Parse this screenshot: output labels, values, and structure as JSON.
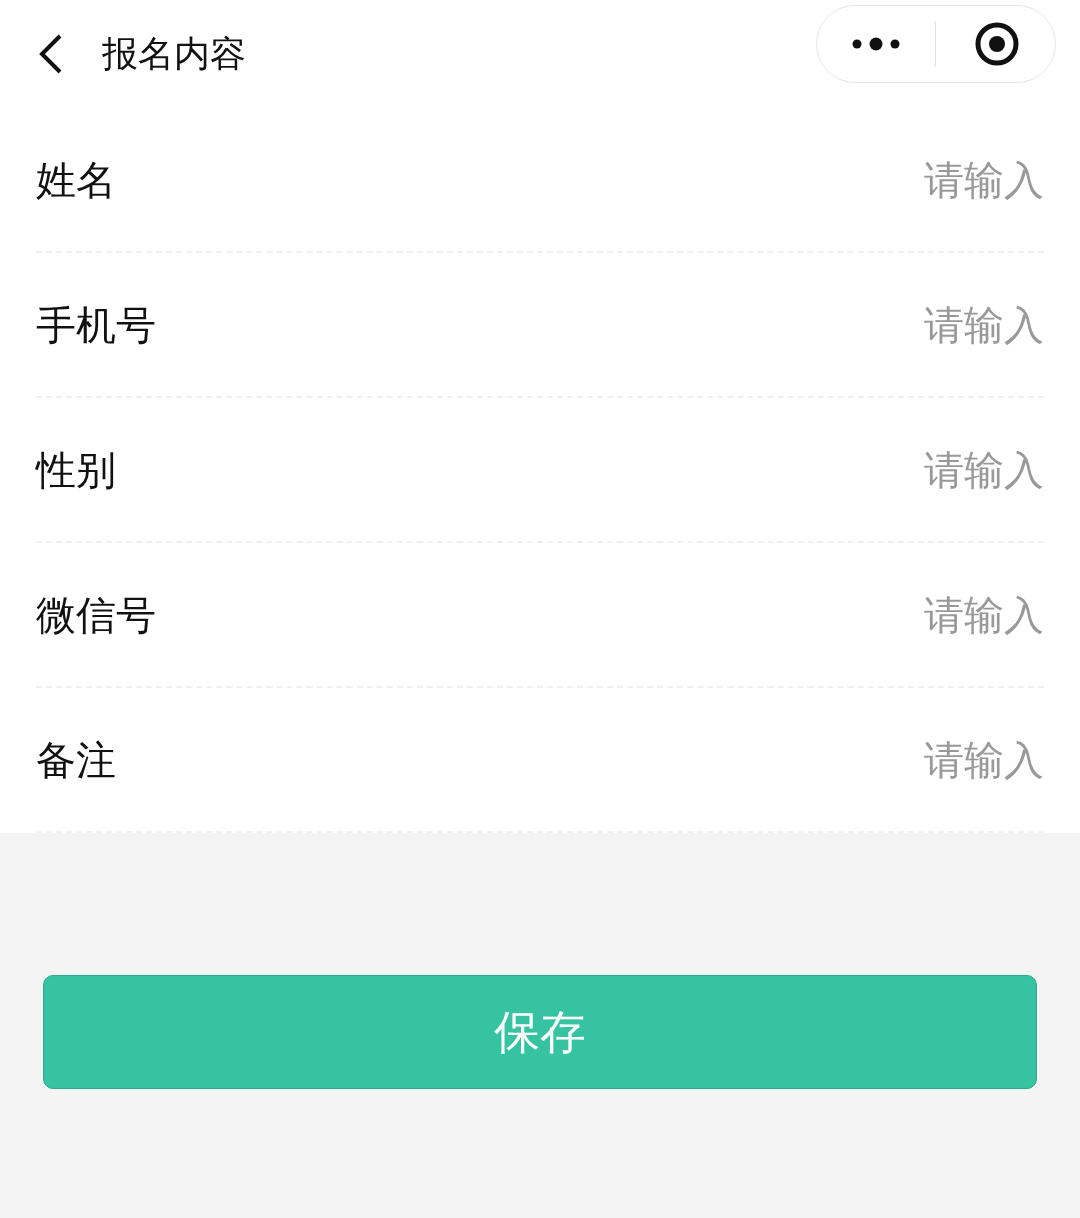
{
  "header": {
    "title": "报名内容"
  },
  "fields": [
    {
      "label": "姓名",
      "placeholder": "请输入"
    },
    {
      "label": "手机号",
      "placeholder": "请输入"
    },
    {
      "label": "性别",
      "placeholder": "请输入"
    },
    {
      "label": "微信号",
      "placeholder": "请输入"
    },
    {
      "label": "备注",
      "placeholder": "请输入"
    }
  ],
  "save_button": "保存"
}
